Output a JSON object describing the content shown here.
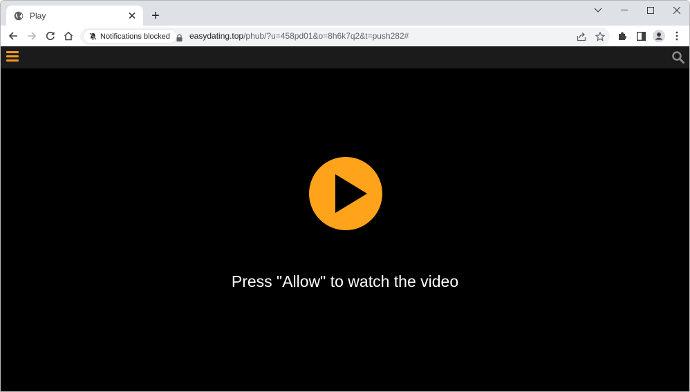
{
  "browser": {
    "tab": {
      "title": "Play",
      "favicon": "globe-icon"
    },
    "new_tab_label": "+",
    "window_controls": [
      "chevron-down-icon",
      "minimize-icon",
      "maximize-icon",
      "close-icon"
    ],
    "nav": [
      "back-icon",
      "forward-icon",
      "reload-icon",
      "home-icon"
    ],
    "notification_chip": "Notifications blocked",
    "url_host": "easydating.top",
    "url_path": "/phub/?u=458pd01&o=8h6k7q2&t=push282#",
    "omnibox_icons": [
      "share-icon",
      "star-icon"
    ],
    "toolbar_icons": [
      "extensions-icon",
      "side-panel-icon",
      "profile-icon",
      "menu-icon"
    ]
  },
  "site": {
    "menu_icon": "hamburger-icon",
    "search_icon": "search-icon",
    "accent": "#ffa31a",
    "play_icon": "play-icon",
    "message": "Press \"Allow\" to watch the video"
  }
}
